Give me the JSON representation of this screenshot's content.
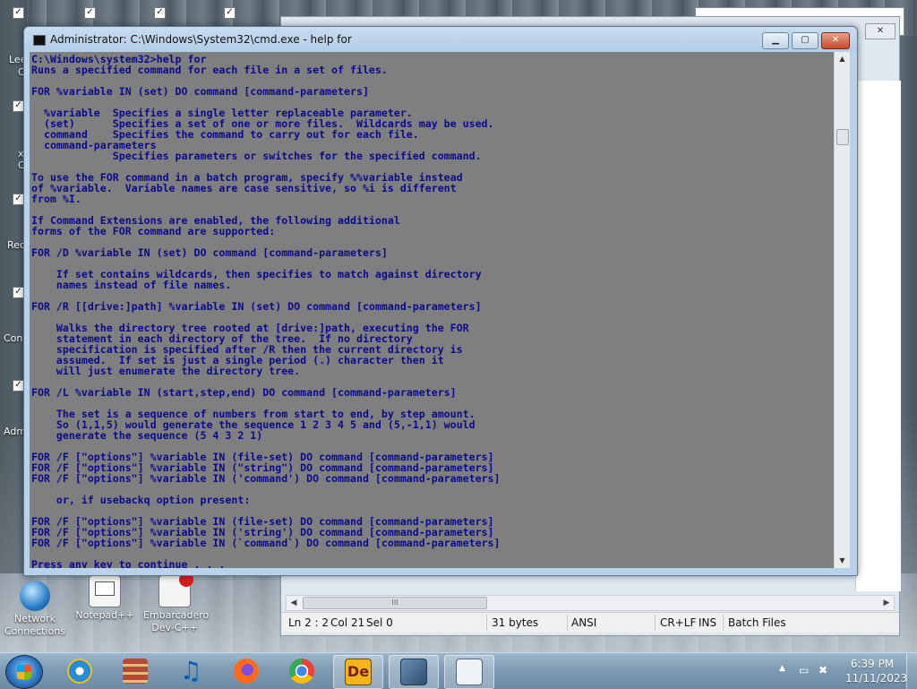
{
  "desktop": {
    "icons": [
      {
        "label": "Network Connections"
      },
      {
        "label": "Notepad++"
      },
      {
        "label": "Embarcadero Dev-C++"
      }
    ],
    "left_labels": [
      "Lee",
      "C",
      "x",
      "C",
      "Rec",
      "Con",
      "Adm"
    ]
  },
  "cmd": {
    "title": "Administrator: C:\\Windows\\System32\\cmd.exe - help  for",
    "lines": [
      "C:\\Windows\\system32>help for",
      "Runs a specified command for each file in a set of files.",
      "",
      "FOR %variable IN (set) DO command [command-parameters]",
      "",
      "  %variable  Specifies a single letter replaceable parameter.",
      "  (set)      Specifies a set of one or more files.  Wildcards may be used.",
      "  command    Specifies the command to carry out for each file.",
      "  command-parameters",
      "             Specifies parameters or switches for the specified command.",
      "",
      "To use the FOR command in a batch program, specify %%variable instead",
      "of %variable.  Variable names are case sensitive, so %i is different",
      "from %I.",
      "",
      "If Command Extensions are enabled, the following additional",
      "forms of the FOR command are supported:",
      "",
      "FOR /D %variable IN (set) DO command [command-parameters]",
      "",
      "    If set contains wildcards, then specifies to match against directory",
      "    names instead of file names.",
      "",
      "FOR /R [[drive:]path] %variable IN (set) DO command [command-parameters]",
      "",
      "    Walks the directory tree rooted at [drive:]path, executing the FOR",
      "    statement in each directory of the tree.  If no directory",
      "    specification is specified after /R then the current directory is",
      "    assumed.  If set is just a single period (.) character then it",
      "    will just enumerate the directory tree.",
      "",
      "FOR /L %variable IN (start,step,end) DO command [command-parameters]",
      "",
      "    The set is a sequence of numbers from start to end, by step amount.",
      "    So (1,1,5) would generate the sequence 1 2 3 4 5 and (5,-1,1) would",
      "    generate the sequence (5 4 3 2 1)",
      "",
      "FOR /F [\"options\"] %variable IN (file-set) DO command [command-parameters]",
      "FOR /F [\"options\"] %variable IN (\"string\") DO command [command-parameters]",
      "FOR /F [\"options\"] %variable IN ('command') DO command [command-parameters]",
      "",
      "    or, if usebackq option present:",
      "",
      "FOR /F [\"options\"] %variable IN (file-set) DO command [command-parameters]",
      "FOR /F [\"options\"] %variable IN ('string') DO command [command-parameters]",
      "FOR /F [\"options\"] %variable IN (`command`) DO command [command-parameters]",
      "",
      "Press any key to continue . . ."
    ]
  },
  "notepadpp": {
    "status": {
      "position": "Ln 2 : 2",
      "col": "Col 21",
      "sel": "Sel 0",
      "length": "31 bytes",
      "encoding": "ANSI",
      "eol": "CR+LF",
      "mode": "INS",
      "language": "Batch Files"
    },
    "scroll_thumb": "III"
  },
  "taskbar": {
    "time": "6:39 PM",
    "date": "11/11/2023",
    "tray_up_arrow": "▲",
    "buttons": [
      "Internet Explorer",
      "Archive Manager",
      "Music",
      "Firefox",
      "Chrome",
      "Delphi",
      "Control Panel",
      "Notepad++"
    ]
  },
  "colors": {
    "console_bg": "#7f7f7f",
    "console_fg": "#0a0a8c",
    "title_bar": "#c9dcef"
  }
}
